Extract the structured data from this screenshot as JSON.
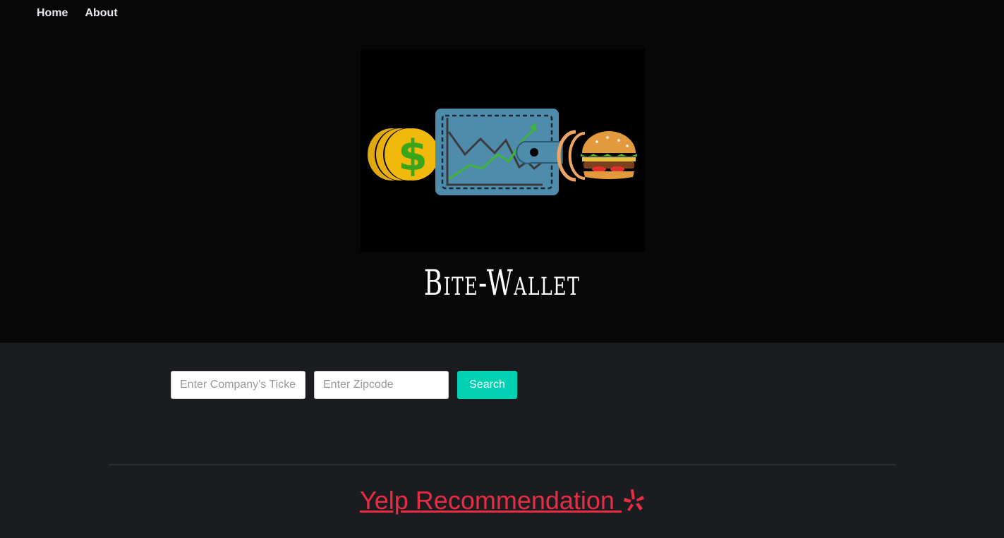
{
  "nav": {
    "items": [
      {
        "label": "Home"
      },
      {
        "label": "About"
      }
    ]
  },
  "hero": {
    "logo_icons": [
      "coin-dollar-icon",
      "wallet-chart-icon",
      "burger-icon"
    ],
    "brand": "Bite-Wallet"
  },
  "search": {
    "ticker_placeholder": "Enter Company's Ticker",
    "zipcode_placeholder": "Enter Zipcode",
    "button_label": "Search"
  },
  "yelp": {
    "title": "Yelp Recommendation ",
    "icon": "yelp-burst-icon"
  },
  "colors": {
    "hero_bg": "#070707",
    "page_bg": "#1b1c20",
    "search_button": "#00d1b2",
    "yelp_red": "#e82c43"
  }
}
